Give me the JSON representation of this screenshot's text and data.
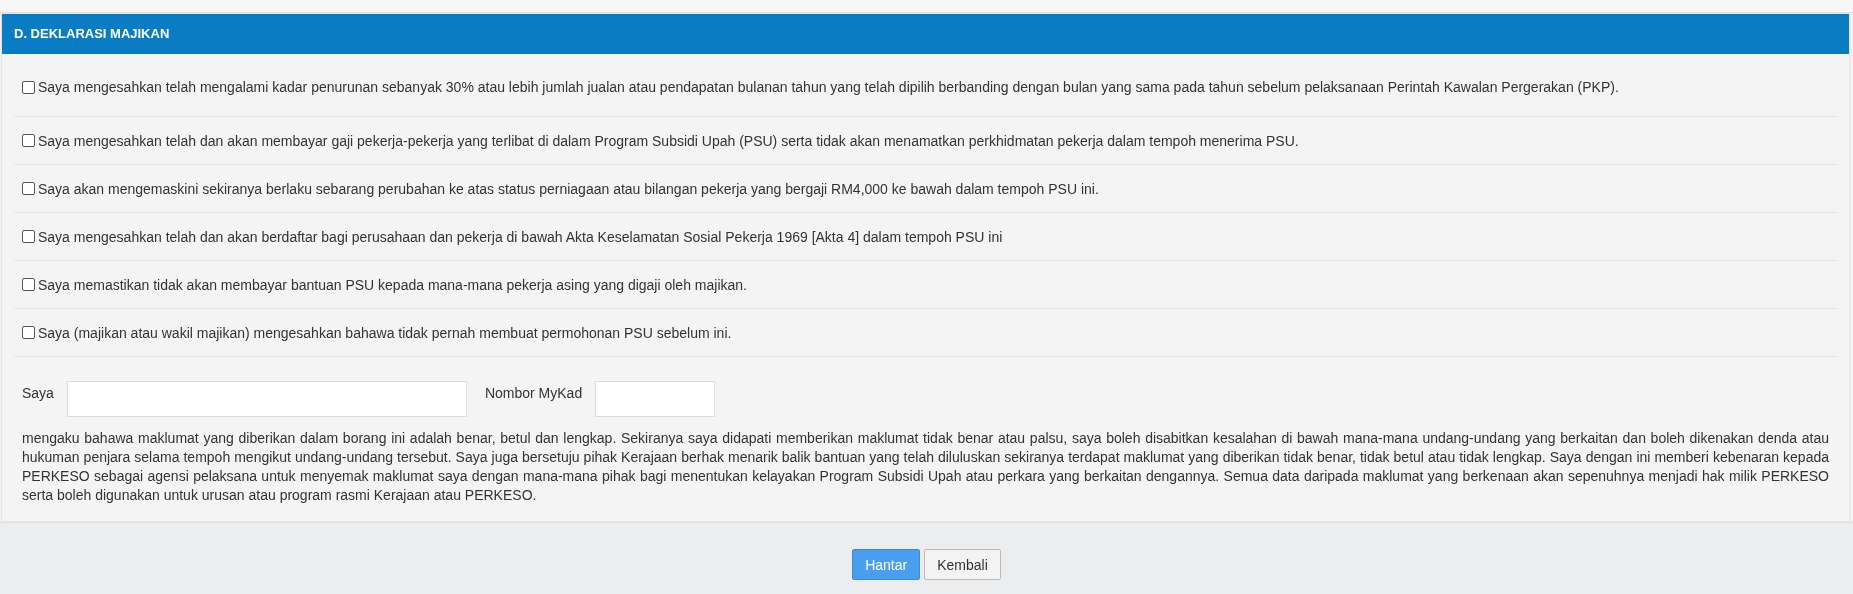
{
  "section": {
    "title": "D. DEKLARASI MAJIKAN"
  },
  "declarations": [
    {
      "label": "Saya mengesahkan telah mengalami kadar penurunan sebanyak 30% atau lebih jumlah jualan atau pendapatan bulanan tahun yang telah dipilih berbanding dengan bulan yang sama pada tahun sebelum pelaksanaan Perintah Kawalan Pergerakan (PKP).",
      "checked": false
    },
    {
      "label": "Saya mengesahkan telah dan akan membayar gaji pekerja-pekerja yang terlibat di dalam Program Subsidi Upah (PSU) serta tidak akan menamatkan perkhidmatan pekerja dalam tempoh menerima PSU.",
      "checked": false
    },
    {
      "label": "Saya akan mengemaskini sekiranya berlaku sebarang perubahan ke atas status perniagaan atau bilangan pekerja yang bergaji RM4,000 ke bawah dalam tempoh PSU ini.",
      "checked": false
    },
    {
      "label": "Saya mengesahkan telah dan akan berdaftar bagi perusahaan dan pekerja di bawah Akta Keselamatan Sosial Pekerja 1969 [Akta 4] dalam tempoh PSU ini",
      "checked": false
    },
    {
      "label": "Saya memastikan tidak akan membayar bantuan PSU kepada mana-mana pekerja asing yang digaji oleh majikan.",
      "checked": false
    },
    {
      "label": "Saya (majikan atau wakil majikan) mengesahkan bahawa tidak pernah membuat permohonan PSU sebelum ini.",
      "checked": false
    }
  ],
  "fields": [
    {
      "label": "Saya",
      "kind": "wide"
    },
    {
      "label": "Nombor MyKad",
      "kind": "narrow"
    }
  ],
  "statement": "mengaku bahawa maklumat yang diberikan dalam borang ini adalah benar, betul dan lengkap. Sekiranya saya didapati memberikan maklumat tidak benar atau palsu, saya boleh disabitkan kesalahan di bawah mana-mana undang-undang yang berkaitan dan boleh dikenakan denda atau hukuman penjara selama tempoh mengikut undang-undang tersebut. Saya juga bersetuju pihak Kerajaan berhak menarik balik bantuan yang telah diluluskan sekiranya terdapat maklumat yang diberikan tidak benar, tidak betul atau tidak lengkap. Saya dengan ini memberi kebenaran kepada PERKESO sebagai agensi pelaksana untuk menyemak maklumat saya dengan mana-mana pihak bagi menentukan kelayakan Program Subsidi Upah atau perkara yang berkaitan dengannya. Semua data daripada maklumat yang berkenaan akan sepenuhnya menjadi hak milik PERKESO serta boleh digunakan untuk urusan atau program rasmi Kerajaan atau PERKESO.",
  "buttons": [
    {
      "label": "Hantar",
      "kind": "primary"
    },
    {
      "label": "Kembali",
      "kind": "default"
    }
  ]
}
